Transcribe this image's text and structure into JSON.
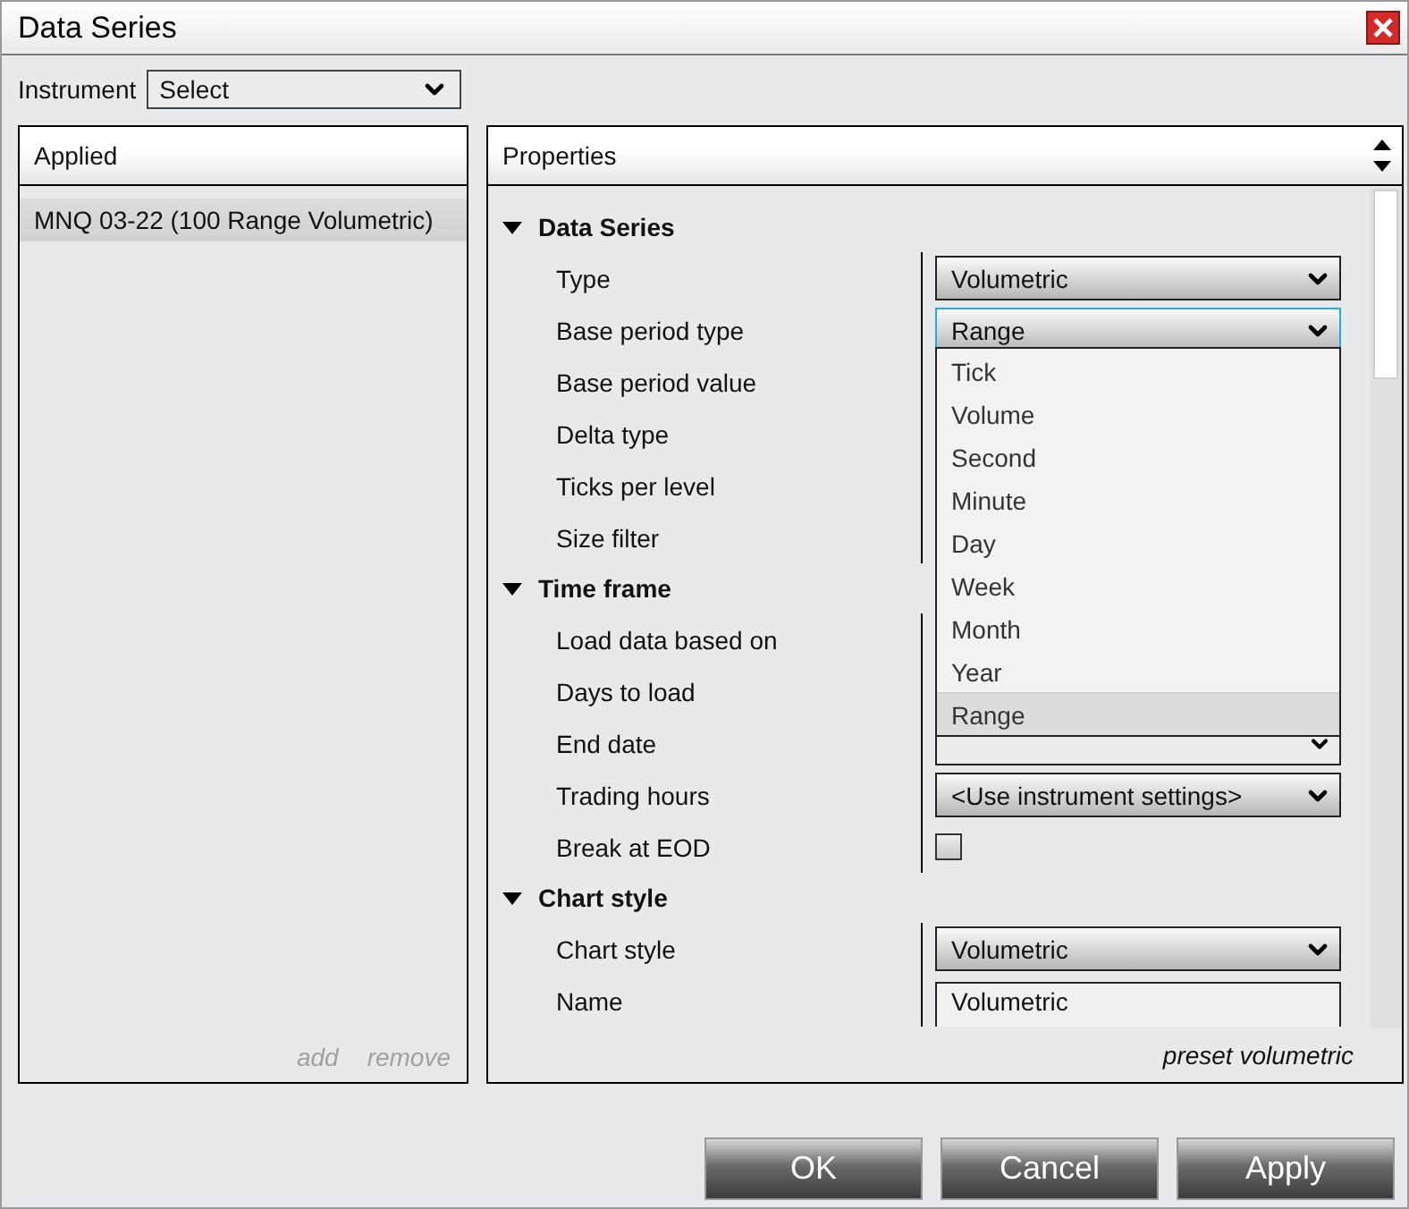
{
  "window": {
    "title": "Data Series"
  },
  "instrument": {
    "label": "Instrument",
    "value": "Select"
  },
  "applied": {
    "title": "Applied",
    "items": [
      {
        "label": "MNQ 03-22 (100 Range Volumetric)",
        "selected": true
      }
    ],
    "links": [
      "add",
      "remove"
    ]
  },
  "properties": {
    "title": "Properties",
    "sections": [
      {
        "title": "Data Series",
        "expanded": true,
        "rows": [
          {
            "label": "Type",
            "kind": "dropdown",
            "value": "Volumetric"
          },
          {
            "label": "Base period type",
            "kind": "dropdown",
            "value": "Range",
            "open": true,
            "focused": true
          },
          {
            "label": "Base period value",
            "kind": "covered"
          },
          {
            "label": "Delta type",
            "kind": "covered"
          },
          {
            "label": "Ticks per level",
            "kind": "covered"
          },
          {
            "label": "Size filter",
            "kind": "covered"
          }
        ]
      },
      {
        "title": "Time frame",
        "expanded": true,
        "rows": [
          {
            "label": "Load data based on",
            "kind": "covered"
          },
          {
            "label": "Days to load",
            "kind": "covered"
          },
          {
            "label": "End date",
            "kind": "date"
          },
          {
            "label": "Trading hours",
            "kind": "dropdown",
            "value": "<Use instrument settings>"
          },
          {
            "label": "Break at EOD",
            "kind": "checkbox",
            "checked": false
          }
        ]
      },
      {
        "title": "Chart style",
        "expanded": true,
        "rows": [
          {
            "label": "Chart style",
            "kind": "dropdown",
            "value": "Volumetric"
          },
          {
            "label": "Name",
            "kind": "text",
            "value": "Volumetric"
          }
        ]
      }
    ],
    "footer": "preset volumetric"
  },
  "dropdown_list": {
    "items": [
      {
        "label": "Tick",
        "selected": false
      },
      {
        "label": "Volume",
        "selected": false
      },
      {
        "label": "Second",
        "selected": false
      },
      {
        "label": "Minute",
        "selected": false
      },
      {
        "label": "Day",
        "selected": false
      },
      {
        "label": "Week",
        "selected": false
      },
      {
        "label": "Month",
        "selected": false
      },
      {
        "label": "Year",
        "selected": false
      },
      {
        "label": "Range",
        "selected": true
      }
    ]
  },
  "buttons": [
    "OK",
    "Cancel",
    "Apply"
  ]
}
